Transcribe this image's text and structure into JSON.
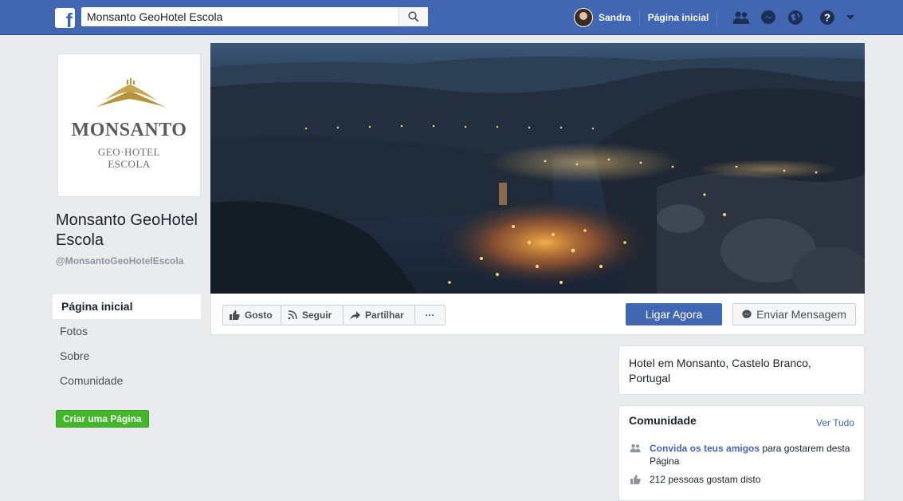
{
  "header": {
    "search_value": "Monsanto GeoHotel Escola",
    "user_name": "Sandra",
    "home_label": "Página inicial"
  },
  "profile": {
    "logo": {
      "main": "MONSANTO",
      "sub1": "GEO·HOTEL",
      "sub2": "ESCOLA"
    },
    "name": "Monsanto GeoHotel Escola",
    "handle": "@MonsantoGeoHotelEscola"
  },
  "left_nav": {
    "items": [
      {
        "label": "Página inicial",
        "active": true
      },
      {
        "label": "Fotos"
      },
      {
        "label": "Sobre"
      },
      {
        "label": "Comunidade"
      }
    ],
    "create_page_label": "Criar uma Página"
  },
  "actions": {
    "like": "Gosto",
    "follow": "Seguir",
    "share": "Partilhar",
    "more": "···",
    "call": "Ligar Agora",
    "message": "Enviar Mensagem"
  },
  "about": {
    "text": "Hotel em Monsanto, Castelo Branco, Portugal"
  },
  "community": {
    "title": "Comunidade",
    "see_all": "Ver Tudo",
    "invite_link": "Convida os teus amigos",
    "invite_rest": " para gostarem desta Página",
    "likes_text": "212 pessoas gostam disto"
  },
  "colors": {
    "brand": "#4267b2",
    "page_bg": "#e9ebee",
    "create_green": "#42b72a"
  },
  "icons": [
    "facebook-logo-icon",
    "search-icon",
    "friends-icon",
    "messenger-icon",
    "globe-icon",
    "help-icon",
    "caret-down-icon",
    "like-icon",
    "rss-icon",
    "share-arrow-icon",
    "messenger-small-icon",
    "people-icon",
    "thumbs-up-icon"
  ]
}
